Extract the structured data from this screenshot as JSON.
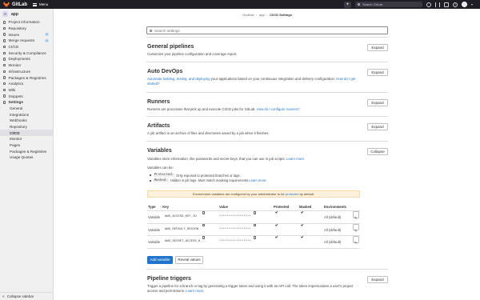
{
  "topbar": {
    "brand": "GitLab",
    "menu_label": "Menu",
    "search_placeholder": "Search GitLab",
    "plus_label": "+"
  },
  "sidebar": {
    "project_avatar": "A",
    "project_name": "app",
    "items": [
      {
        "label": "Project information",
        "icon": "info-icon"
      },
      {
        "label": "Repository",
        "icon": "repository-icon"
      },
      {
        "label": "Issues",
        "icon": "issues-icon",
        "badge": "0"
      },
      {
        "label": "Merge requests",
        "icon": "merge-request-icon",
        "badge": "0"
      },
      {
        "label": "CI/CD",
        "icon": "rocket-icon"
      },
      {
        "label": "Security & Compliance",
        "icon": "shield-icon"
      },
      {
        "label": "Deployments",
        "icon": "deployments-icon"
      },
      {
        "label": "Monitor",
        "icon": "monitor-icon"
      },
      {
        "label": "Infrastructure",
        "icon": "cloud-icon"
      },
      {
        "label": "Packages & Registries",
        "icon": "package-icon"
      },
      {
        "label": "Analytics",
        "icon": "chart-icon"
      },
      {
        "label": "Wiki",
        "icon": "book-icon"
      },
      {
        "label": "Snippets",
        "icon": "snippet-icon"
      },
      {
        "label": "Settings",
        "icon": "gear-icon"
      }
    ],
    "settings_sub": [
      "General",
      "Integrations",
      "Webhooks",
      "Repository",
      "CI/CD",
      "Monitor",
      "Pages",
      "Packages & Registries",
      "Usage Quotas"
    ],
    "active_sub": "CI/CD",
    "collapse_label": "Collapse sidebar"
  },
  "breadcrumb": {
    "items": [
      "Ovolhav",
      "app",
      "CI/CD Settings"
    ]
  },
  "search": {
    "placeholder": "Search settings"
  },
  "sections": {
    "general": {
      "title": "General pipelines",
      "desc": "Customize your pipeline configuration and coverage report.",
      "button": "Expand"
    },
    "autodevops": {
      "title": "Auto DevOps",
      "desc_link": "Automate building, testing, and deploying",
      "desc": " your applications based on your continuous integration and delivery configuration. ",
      "desc_link2": "How do I get started?",
      "button": "Expand"
    },
    "runners": {
      "title": "Runners",
      "desc": "Runners are processes that pick up and execute CI/CD jobs for GitLab. ",
      "desc_link": "How do I configure runners?",
      "button": "Expand"
    },
    "artifacts": {
      "title": "Artifacts",
      "desc": "A job artifact is an archive of files and directories saved by a job when it finishes.",
      "button": "Expand"
    },
    "variables": {
      "title": "Variables",
      "button": "Collapse",
      "desc": "Variables store information, like passwords and secret keys, that you can use in job scripts. ",
      "desc_link": "Learn more.",
      "can_be": "Variables can be:",
      "bullets": [
        {
          "code": "Protected:",
          "text": "Only exposed to protected branches or tags.",
          "link": ""
        },
        {
          "code": "Masked:",
          "text": "Hidden in job logs. Must match masking requirements. ",
          "link": "Learn more."
        }
      ],
      "alert_text": "Environment variables are configured by your administrator to be ",
      "alert_link": "protected",
      "alert_tail": " by default.",
      "columns": [
        "Type",
        "↑ Key",
        "Value",
        "Protected",
        "Masked",
        "Environments"
      ],
      "rows": [
        {
          "type": "Variable",
          "key": "AWS_ACCESS_KEY_ID",
          "value": "*****************",
          "env": "All (default)"
        },
        {
          "type": "Variable",
          "key": "AWS_DEFAULT_REGION",
          "value": "*****************",
          "env": "All (default)"
        },
        {
          "type": "Variable",
          "key": "AWS_SECRET_ACCESS_K...",
          "value": "*****************",
          "env": "All (default)"
        }
      ],
      "add_button": "Add variable",
      "reveal_button": "Reveal values"
    },
    "triggers": {
      "title": "Pipeline triggers",
      "desc": "Trigger a pipeline for a branch or tag by generating a trigger token and using it with an API call. The token impersonates a user's project access and permissions. ",
      "desc_link": "Learn more.",
      "button": "Expand"
    }
  },
  "colors": {
    "topbar": "#1f1e24",
    "brand": "#fc6d26",
    "link": "#1f75cb",
    "alert_bg": "#fdf1dd"
  }
}
